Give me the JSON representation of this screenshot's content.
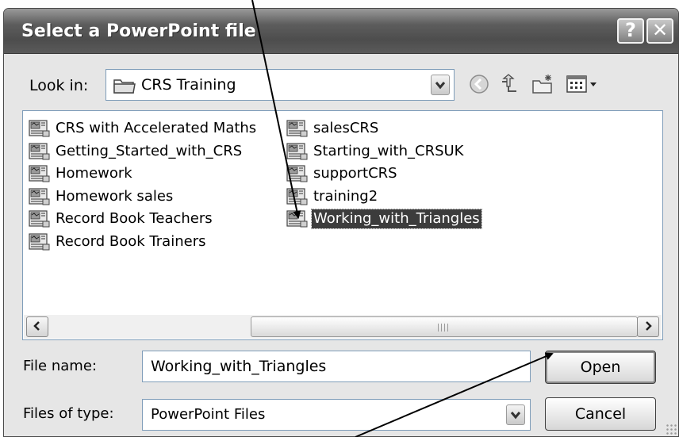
{
  "window": {
    "title": "Select a PowerPoint file",
    "help_label": "?",
    "close_label": "✕"
  },
  "lookin": {
    "label": "Look in:",
    "value": "CRS Training"
  },
  "toolbar": {
    "icons": [
      "back-icon",
      "up-folder-icon",
      "new-folder-icon",
      "view-menu-icon"
    ]
  },
  "files": {
    "column1": [
      "CRS with Accelerated Maths",
      "Getting_Started_with_CRS",
      "Homework",
      "Homework sales",
      "Record Book Teachers",
      "Record Book Trainers"
    ],
    "column2": [
      "salesCRS",
      "Starting_with_CRSUK",
      "supportCRS",
      "training2",
      "Working_with_Triangles"
    ],
    "selected": "Working_with_Triangles"
  },
  "filename": {
    "label": "File name:",
    "value": "Working_with_Triangles"
  },
  "filetype": {
    "label": "Files of type:",
    "value": "PowerPoint Files"
  },
  "buttons": {
    "open": "Open",
    "cancel": "Cancel"
  },
  "colors": {
    "titlebar": "#4d4d4d",
    "selection": "#3c3c3c",
    "dialog_bg": "#e6e6e6"
  }
}
